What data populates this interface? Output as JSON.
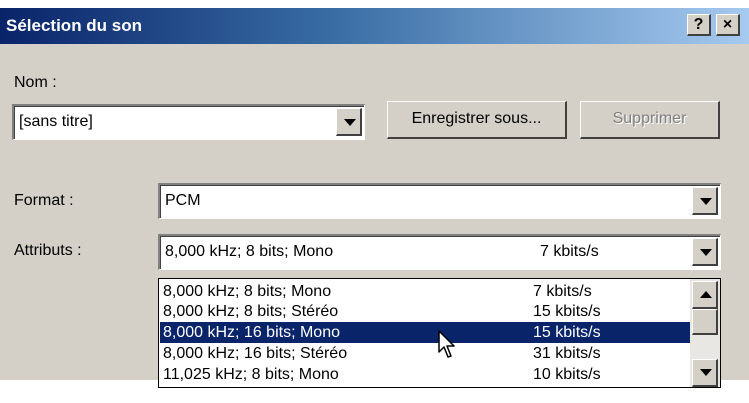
{
  "window": {
    "title": "Sélection du son",
    "help_button": "?",
    "close_button": "×"
  },
  "name_section": {
    "label": "Nom :",
    "value": "[sans titre]",
    "save_as_button": "Enregistrer sous...",
    "delete_button": "Supprimer"
  },
  "format": {
    "label": "Format :",
    "value": "PCM"
  },
  "attributes": {
    "label": "Attributs :",
    "selected_attr": "8,000 kHz; 8 bits; Mono",
    "selected_rate": "7 kbits/s",
    "options": [
      {
        "attr": "8,000 kHz; 8 bits; Mono",
        "rate": "7 kbits/s"
      },
      {
        "attr": "8,000 kHz; 8 bits; Stéréo",
        "rate": "15 kbits/s"
      },
      {
        "attr": "8,000 kHz; 16 bits; Mono",
        "rate": "15 kbits/s"
      },
      {
        "attr": "8,000 kHz; 16 bits; Stéréo",
        "rate": "31 kbits/s"
      },
      {
        "attr": "11,025 kHz; 8 bits; Mono",
        "rate": "10 kbits/s"
      }
    ],
    "highlighted_index": 2
  },
  "icons": {
    "dropdown": "chevron-down-icon",
    "scroll_up": "arrow-up-icon",
    "scroll_down": "arrow-down-icon",
    "cursor": "mouse-pointer-icon"
  },
  "colors": {
    "title_bar": "#0a246a",
    "selection": "#0a246a",
    "dialog_face": "#d4d0c8"
  }
}
